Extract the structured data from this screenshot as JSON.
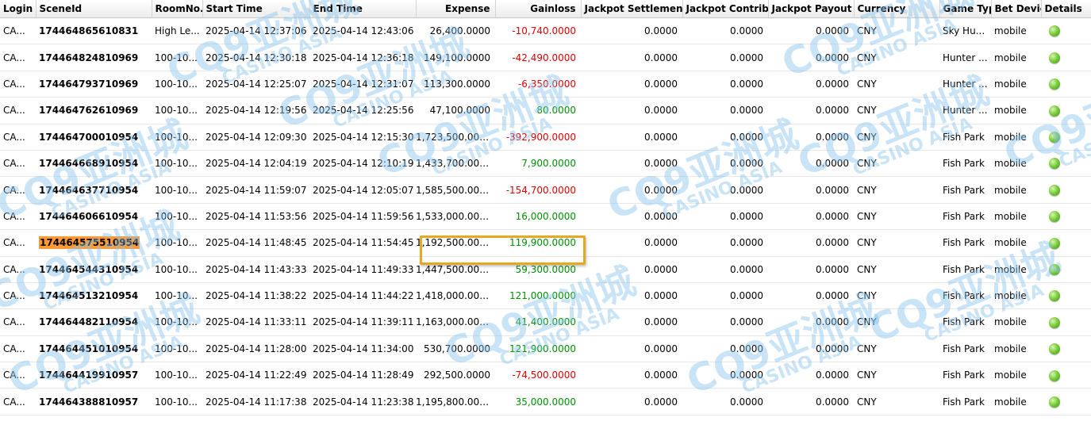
{
  "columns": [
    "Login",
    "SceneId",
    "RoomNo...",
    "Start Time",
    "End Time",
    "Expense",
    "Gainloss",
    "Jackpot Settlement",
    "Jackpot Contribu",
    "Jackpot Payout",
    "Currency",
    "Game Typ",
    "Bet Devic",
    "Details"
  ],
  "watermark": {
    "text": "CQ9亚洲城",
    "sub": "CASINO ASIA"
  },
  "colors": {
    "negative": "#e00000",
    "positive": "#009000",
    "highlight": "#ff9933",
    "box": "#e5a823"
  },
  "rows": [
    {
      "login": "CA...",
      "scene": "174464865610831",
      "room": "High Le...",
      "start": "2025-04-14 12:37:06",
      "end": "2025-04-14 12:43:06",
      "expense": "26,400.0000",
      "gain": "-10,740.0000",
      "sign": "neg",
      "js": "0.0000",
      "jc": "0.0000",
      "jp": "0.0000",
      "cur": "CNY",
      "game": "Sky Hu...",
      "device": "mobile"
    },
    {
      "login": "CA...",
      "scene": "174464824810969",
      "room": "100-10...",
      "start": "2025-04-14 12:30:18",
      "end": "2025-04-14 12:36:18",
      "expense": "149,100.0000",
      "gain": "-42,490.0000",
      "sign": "neg",
      "js": "0.0000",
      "jc": "0.0000",
      "jp": "0.0000",
      "cur": "CNY",
      "game": "Hunter ...",
      "device": "mobile"
    },
    {
      "login": "CA...",
      "scene": "174464793710969",
      "room": "100-10...",
      "start": "2025-04-14 12:25:07",
      "end": "2025-04-14 12:31:07",
      "expense": "113,300.0000",
      "gain": "-6,350.0000",
      "sign": "neg",
      "js": "0.0000",
      "jc": "0.0000",
      "jp": "0.0000",
      "cur": "CNY",
      "game": "Hunter ...",
      "device": "mobile"
    },
    {
      "login": "CA...",
      "scene": "174464762610969",
      "room": "100-10...",
      "start": "2025-04-14 12:19:56",
      "end": "2025-04-14 12:25:56",
      "expense": "47,100.0000",
      "gain": "80.0000",
      "sign": "pos",
      "js": "0.0000",
      "jc": "0.0000",
      "jp": "0.0000",
      "cur": "CNY",
      "game": "Hunter ...",
      "device": "mobile"
    },
    {
      "login": "CA...",
      "scene": "174464700010954",
      "room": "100-10...",
      "start": "2025-04-14 12:09:30",
      "end": "2025-04-14 12:15:30",
      "expense": "1,723,500.0000",
      "gain": "-392,900.0000",
      "sign": "neg",
      "js": "0.0000",
      "jc": "0.0000",
      "jp": "0.0000",
      "cur": "CNY",
      "game": "Fish Park",
      "device": "mobile"
    },
    {
      "login": "CA...",
      "scene": "174464668910954",
      "room": "100-10...",
      "start": "2025-04-14 12:04:19",
      "end": "2025-04-14 12:10:19",
      "expense": "1,433,700.0000",
      "gain": "7,900.0000",
      "sign": "pos",
      "js": "0.0000",
      "jc": "0.0000",
      "jp": "0.0000",
      "cur": "CNY",
      "game": "Fish Park",
      "device": "mobile"
    },
    {
      "login": "CA...",
      "scene": "174464637710954",
      "room": "100-10...",
      "start": "2025-04-14 11:59:07",
      "end": "2025-04-14 12:05:07",
      "expense": "1,585,500.0000",
      "gain": "-154,700.0000",
      "sign": "neg",
      "js": "0.0000",
      "jc": "0.0000",
      "jp": "0.0000",
      "cur": "CNY",
      "game": "Fish Park",
      "device": "mobile"
    },
    {
      "login": "CA...",
      "scene": "174464606610954",
      "room": "100-10...",
      "start": "2025-04-14 11:53:56",
      "end": "2025-04-14 11:59:56",
      "expense": "1,533,000.0000",
      "gain": "16,000.0000",
      "sign": "pos",
      "js": "0.0000",
      "jc": "0.0000",
      "jp": "0.0000",
      "cur": "CNY",
      "game": "Fish Park",
      "device": "mobile"
    },
    {
      "login": "CA...",
      "scene": "174464575510954",
      "room": "100-10...",
      "start": "2025-04-14 11:48:45",
      "end": "2025-04-14 11:54:45",
      "expense": "1,192,500.0000",
      "gain": "119,900.0000",
      "sign": "pos",
      "js": "0.0000",
      "jc": "0.0000",
      "jp": "0.0000",
      "cur": "CNY",
      "game": "Fish Park",
      "device": "mobile",
      "highlight": true
    },
    {
      "login": "CA...",
      "scene": "174464544310954",
      "room": "100-10...",
      "start": "2025-04-14 11:43:33",
      "end": "2025-04-14 11:49:33",
      "expense": "1,447,500.0000",
      "gain": "59,300.0000",
      "sign": "pos",
      "js": "0.0000",
      "jc": "0.0000",
      "jp": "0.0000",
      "cur": "CNY",
      "game": "Fish Park",
      "device": "mobile"
    },
    {
      "login": "CA...",
      "scene": "174464513210954",
      "room": "100-10...",
      "start": "2025-04-14 11:38:22",
      "end": "2025-04-14 11:44:22",
      "expense": "1,418,000.0000",
      "gain": "121,000.0000",
      "sign": "pos",
      "js": "0.0000",
      "jc": "0.0000",
      "jp": "0.0000",
      "cur": "CNY",
      "game": "Fish Park",
      "device": "mobile"
    },
    {
      "login": "CA...",
      "scene": "174464482110954",
      "room": "100-10...",
      "start": "2025-04-14 11:33:11",
      "end": "2025-04-14 11:39:11",
      "expense": "1,163,000.0000",
      "gain": "41,400.0000",
      "sign": "pos",
      "js": "0.0000",
      "jc": "0.0000",
      "jp": "0.0000",
      "cur": "CNY",
      "game": "Fish Park",
      "device": "mobile"
    },
    {
      "login": "CA...",
      "scene": "174464451010954",
      "room": "100-10...",
      "start": "2025-04-14 11:28:00",
      "end": "2025-04-14 11:34:00",
      "expense": "530,700.0000",
      "gain": "121,900.0000",
      "sign": "pos",
      "js": "0.0000",
      "jc": "0.0000",
      "jp": "0.0000",
      "cur": "CNY",
      "game": "Fish Park",
      "device": "mobile"
    },
    {
      "login": "CA...",
      "scene": "174464419910957",
      "room": "100-10...",
      "start": "2025-04-14 11:22:49",
      "end": "2025-04-14 11:28:49",
      "expense": "292,500.0000",
      "gain": "-74,500.0000",
      "sign": "neg",
      "js": "0.0000",
      "jc": "0.0000",
      "jp": "0.0000",
      "cur": "CNY",
      "game": "Fish Park",
      "device": "mobile"
    },
    {
      "login": "CA...",
      "scene": "174464388810957",
      "room": "100-10...",
      "start": "2025-04-14 11:17:38",
      "end": "2025-04-14 11:23:38",
      "expense": "1,195,800.0000",
      "gain": "35,000.0000",
      "sign": "pos",
      "js": "0.0000",
      "jc": "0.0000",
      "jp": "0.0000",
      "cur": "CNY",
      "game": "Fish Park",
      "device": "mobile"
    }
  ]
}
